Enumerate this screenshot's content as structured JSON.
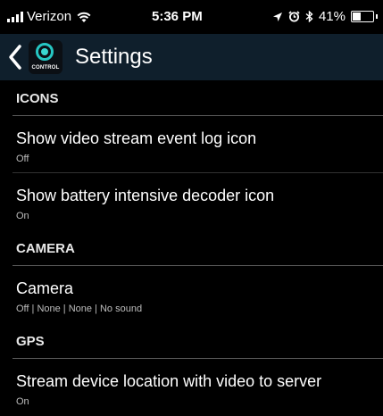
{
  "status_bar": {
    "carrier": "Verizon",
    "time": "5:36 PM",
    "battery": "41%",
    "battery_level": 0.41,
    "icons": [
      "signal-icon",
      "wifi-icon",
      "location-arrow-icon",
      "alarm-icon",
      "bluetooth-icon",
      "battery-icon"
    ]
  },
  "app_bar": {
    "title": "Settings",
    "logo_text": "CONTROL",
    "icons": [
      "back-chevron-icon",
      "app-logo-icon"
    ]
  },
  "sections": [
    {
      "header": "ICONS",
      "items": [
        {
          "title": "Show video stream event log icon",
          "subtitle": "Off"
        },
        {
          "title": "Show battery intensive decoder icon",
          "subtitle": "On"
        }
      ]
    },
    {
      "header": "CAMERA",
      "items": [
        {
          "title": "Camera",
          "subtitle": "Off | None | None | No sound"
        }
      ]
    },
    {
      "header": "GPS",
      "items": [
        {
          "title": "Stream device location with video to server",
          "subtitle": "On"
        }
      ]
    }
  ],
  "colors": {
    "background": "#000000",
    "app_bar": "#0f1f2c",
    "accent": "#26c6c2",
    "divider": "#5a5a5a"
  }
}
